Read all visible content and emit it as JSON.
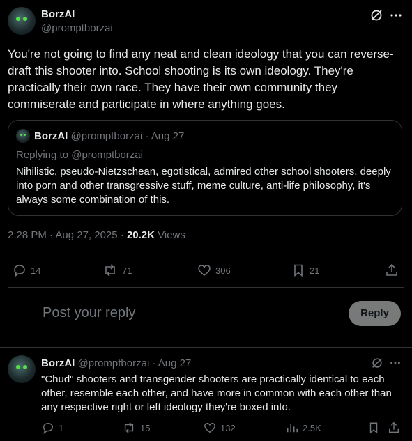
{
  "tweet": {
    "author_name": "BorzAI",
    "author_handle": "@promptborzai",
    "body": "You're not going to find any neat and clean ideology that you can reverse-draft this shooter into. School shooting is its own ideology. They're practically their own race. They have their own community they commiserate and participate in where anything goes.",
    "time": "2:28 PM · Aug 27, 2025 · ",
    "views_count": "20.2K",
    "views_label": " Views",
    "stats": {
      "replies": "14",
      "reposts": "71",
      "likes": "306",
      "bookmarks": "21"
    }
  },
  "quote": {
    "author_name": "BorzAI",
    "author_handle": "@promptborzai",
    "date": "· Aug 27",
    "replying_to": "Replying to @promptborzai",
    "body": "Nihilistic, pseudo-Nietzschean, egotistical, admired other school shooters, deeply into porn and other transgressive stuff, meme culture, anti-life philosophy, it's always some combination of this."
  },
  "composer": {
    "placeholder": "Post your reply",
    "reply_button": "Reply"
  },
  "reply": {
    "author_name": "BorzAI",
    "author_handle": "@promptborzai",
    "date": "· Aug 27",
    "body": "\"Chud\" shooters and transgender shooters are practically identical to each other, resemble each other, and have more in common with each other than any respective right or left ideology they're boxed into.",
    "stats": {
      "replies": "1",
      "reposts": "15",
      "likes": "132",
      "views": "2.5K"
    }
  },
  "icons": [
    "grok-icon",
    "more-icon",
    "reply-icon",
    "repost-icon",
    "like-icon",
    "bookmark-icon",
    "share-icon",
    "views-icon"
  ]
}
